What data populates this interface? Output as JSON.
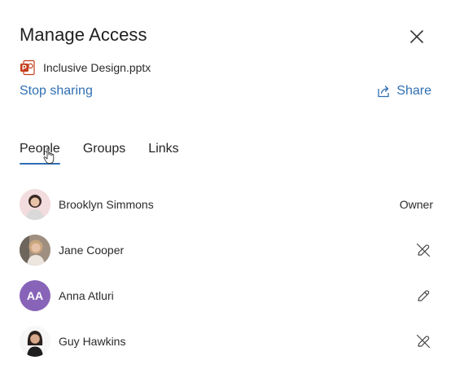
{
  "dialog": {
    "title": "Manage Access",
    "close_icon": "close-icon"
  },
  "file": {
    "icon": "powerpoint-file-icon",
    "name": "Inclusive Design.pptx",
    "icon_color": "#c43e1c"
  },
  "actions": {
    "stop_sharing_label": "Stop sharing",
    "share_label": "Share",
    "share_icon": "share-icon",
    "link_color": "#2f6fb3"
  },
  "tabs": [
    {
      "label": "People",
      "active": true
    },
    {
      "label": "Groups",
      "active": false
    },
    {
      "label": "Links",
      "active": false
    }
  ],
  "people": [
    {
      "name": "Brooklyn Simmons",
      "avatar": "photo-avatar",
      "permission": "Owner",
      "action_icon": ""
    },
    {
      "name": "Jane Cooper",
      "avatar": "photo-avatar",
      "permission": "",
      "action_icon": "no-edit-icon"
    },
    {
      "name": "Anna Atluri",
      "avatar_initials": "AA",
      "avatar_color": "#8764b8",
      "permission": "",
      "action_icon": "edit-pencil-icon"
    },
    {
      "name": "Guy Hawkins",
      "avatar": "photo-avatar",
      "permission": "",
      "action_icon": "no-edit-icon"
    }
  ]
}
